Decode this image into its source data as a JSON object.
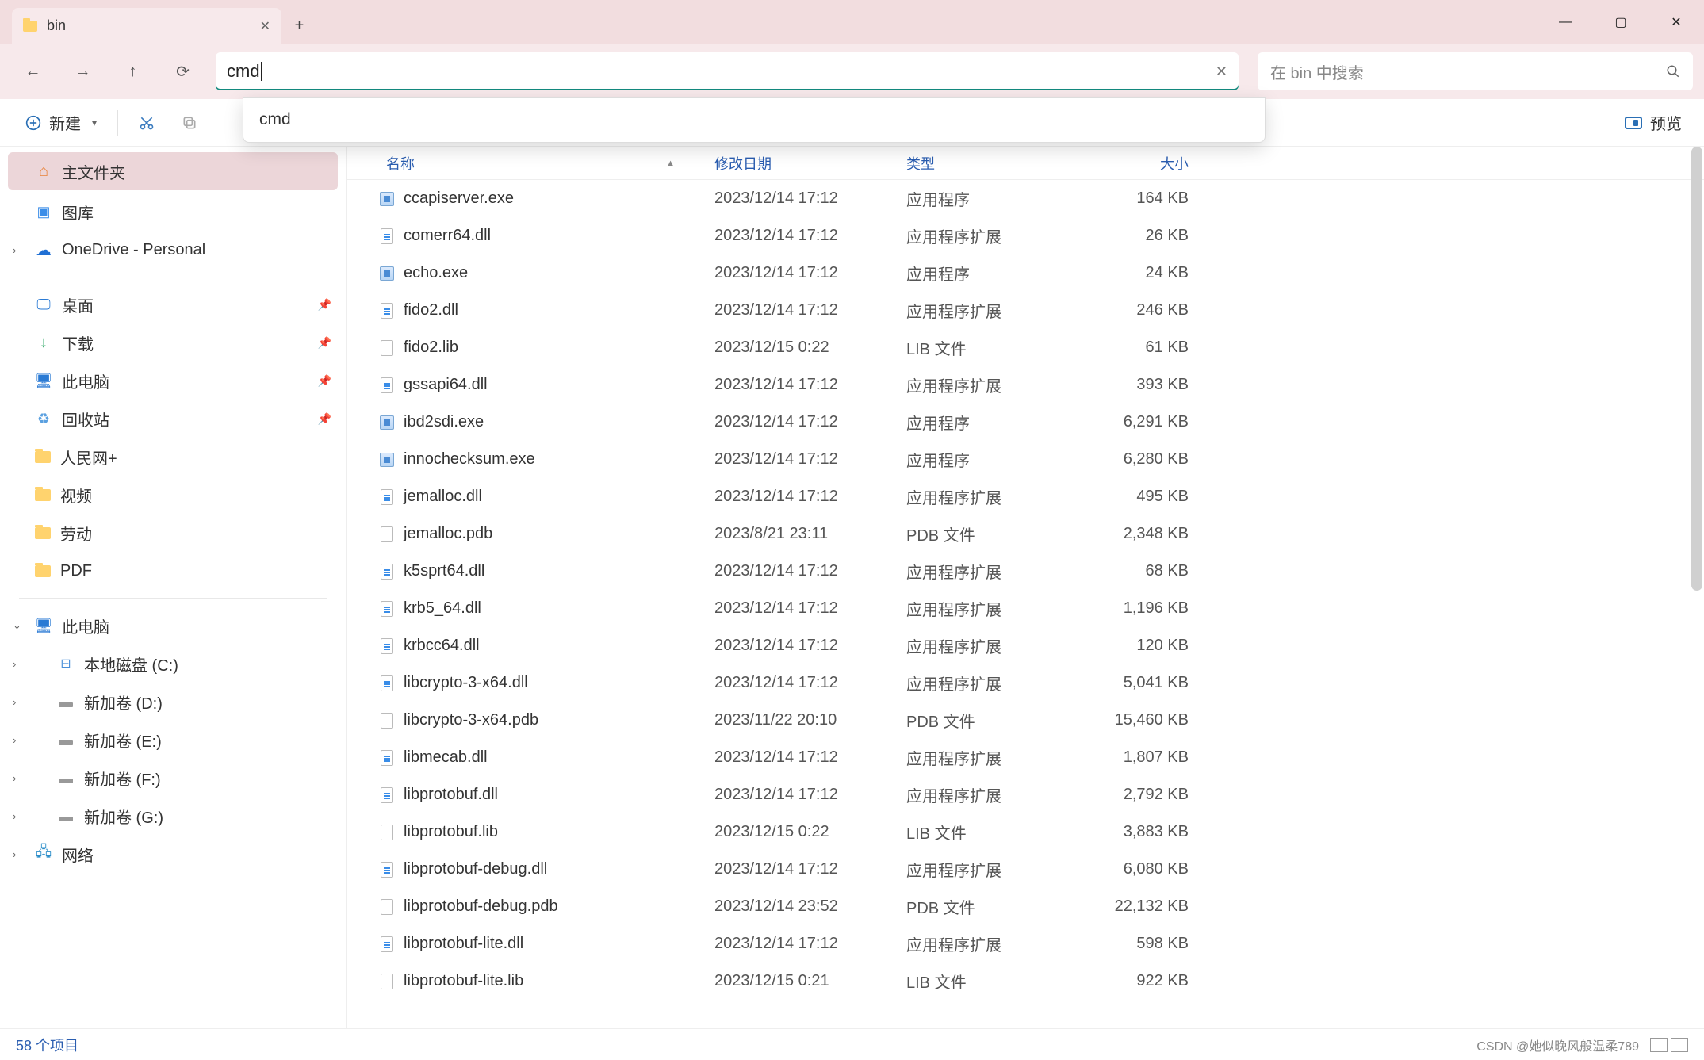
{
  "window": {
    "tab_title": "bin",
    "min": "—",
    "max": "▢",
    "close": "✕",
    "newtab": "+",
    "tab_close": "✕"
  },
  "nav": {
    "back": "←",
    "fwd": "→",
    "up": "↑",
    "refresh": "⟳",
    "address_value": "cmd",
    "clear": "✕"
  },
  "search": {
    "placeholder": "在 bin 中搜索"
  },
  "suggestion": {
    "item0": "cmd"
  },
  "toolbar": {
    "new_label": "新建",
    "preview_label": "预览"
  },
  "sidebar": {
    "home": "主文件夹",
    "pictures": "图库",
    "onedrive": "OneDrive - Personal",
    "desktop": "桌面",
    "downloads": "下载",
    "thispc": "此电脑",
    "recycle": "回收站",
    "f_renmin": "人民网+",
    "f_video": "视频",
    "f_laodong": "劳动",
    "f_pdf": "PDF",
    "thispc2": "此电脑",
    "disk_c": "本地磁盘 (C:)",
    "disk_d": "新加卷 (D:)",
    "disk_e": "新加卷 (E:)",
    "disk_f": "新加卷 (F:)",
    "disk_g": "新加卷 (G:)",
    "network": "网络"
  },
  "columns": {
    "name": "名称",
    "date": "修改日期",
    "type": "类型",
    "size": "大小"
  },
  "types": {
    "app": "应用程序",
    "dll": "应用程序扩展",
    "lib": "LIB 文件",
    "pdb": "PDB 文件"
  },
  "files": [
    {
      "icon": "exe",
      "name": "ccapiserver.exe",
      "date": "2023/12/14 17:12",
      "type": "app",
      "size": "164 KB"
    },
    {
      "icon": "dll",
      "name": "comerr64.dll",
      "date": "2023/12/14 17:12",
      "type": "dll",
      "size": "26 KB"
    },
    {
      "icon": "exe",
      "name": "echo.exe",
      "date": "2023/12/14 17:12",
      "type": "app",
      "size": "24 KB"
    },
    {
      "icon": "dll",
      "name": "fido2.dll",
      "date": "2023/12/14 17:12",
      "type": "dll",
      "size": "246 KB"
    },
    {
      "icon": "file",
      "name": "fido2.lib",
      "date": "2023/12/15 0:22",
      "type": "lib",
      "size": "61 KB"
    },
    {
      "icon": "dll",
      "name": "gssapi64.dll",
      "date": "2023/12/14 17:12",
      "type": "dll",
      "size": "393 KB"
    },
    {
      "icon": "exe",
      "name": "ibd2sdi.exe",
      "date": "2023/12/14 17:12",
      "type": "app",
      "size": "6,291 KB"
    },
    {
      "icon": "exe",
      "name": "innochecksum.exe",
      "date": "2023/12/14 17:12",
      "type": "app",
      "size": "6,280 KB"
    },
    {
      "icon": "dll",
      "name": "jemalloc.dll",
      "date": "2023/12/14 17:12",
      "type": "dll",
      "size": "495 KB"
    },
    {
      "icon": "file",
      "name": "jemalloc.pdb",
      "date": "2023/8/21 23:11",
      "type": "pdb",
      "size": "2,348 KB"
    },
    {
      "icon": "dll",
      "name": "k5sprt64.dll",
      "date": "2023/12/14 17:12",
      "type": "dll",
      "size": "68 KB"
    },
    {
      "icon": "dll",
      "name": "krb5_64.dll",
      "date": "2023/12/14 17:12",
      "type": "dll",
      "size": "1,196 KB"
    },
    {
      "icon": "dll",
      "name": "krbcc64.dll",
      "date": "2023/12/14 17:12",
      "type": "dll",
      "size": "120 KB"
    },
    {
      "icon": "dll",
      "name": "libcrypto-3-x64.dll",
      "date": "2023/12/14 17:12",
      "type": "dll",
      "size": "5,041 KB"
    },
    {
      "icon": "file",
      "name": "libcrypto-3-x64.pdb",
      "date": "2023/11/22 20:10",
      "type": "pdb",
      "size": "15,460 KB"
    },
    {
      "icon": "dll",
      "name": "libmecab.dll",
      "date": "2023/12/14 17:12",
      "type": "dll",
      "size": "1,807 KB"
    },
    {
      "icon": "dll",
      "name": "libprotobuf.dll",
      "date": "2023/12/14 17:12",
      "type": "dll",
      "size": "2,792 KB"
    },
    {
      "icon": "file",
      "name": "libprotobuf.lib",
      "date": "2023/12/15 0:22",
      "type": "lib",
      "size": "3,883 KB"
    },
    {
      "icon": "dll",
      "name": "libprotobuf-debug.dll",
      "date": "2023/12/14 17:12",
      "type": "dll",
      "size": "6,080 KB"
    },
    {
      "icon": "file",
      "name": "libprotobuf-debug.pdb",
      "date": "2023/12/14 23:52",
      "type": "pdb",
      "size": "22,132 KB"
    },
    {
      "icon": "dll",
      "name": "libprotobuf-lite.dll",
      "date": "2023/12/14 17:12",
      "type": "dll",
      "size": "598 KB"
    },
    {
      "icon": "file",
      "name": "libprotobuf-lite.lib",
      "date": "2023/12/15 0:21",
      "type": "lib",
      "size": "922 KB"
    }
  ],
  "status": {
    "count": "58 个项目",
    "watermark": "CSDN @她似晚风般温柔789"
  }
}
